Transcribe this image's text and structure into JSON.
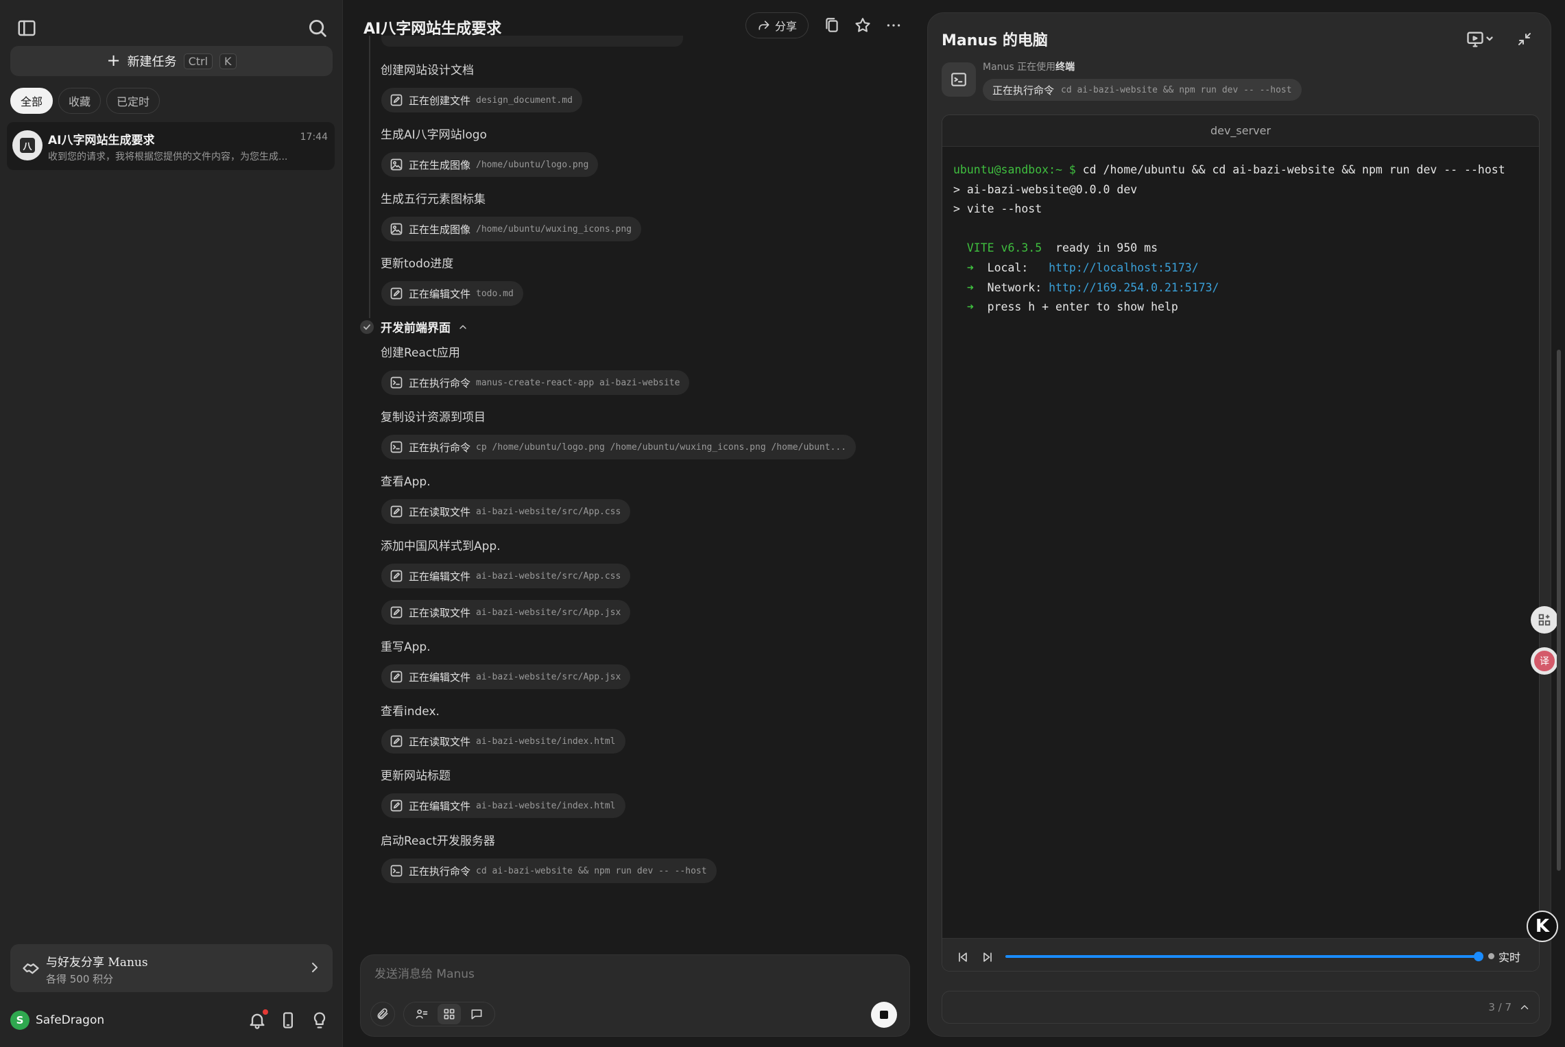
{
  "sidebar": {
    "new_task_label": "新建任务",
    "shortcut_ctrl": "Ctrl",
    "shortcut_key": "K",
    "filters": [
      "全部",
      "收藏",
      "已定时"
    ],
    "task": {
      "title": "AI八字网站生成要求",
      "time": "17:44",
      "preview": "收到您的请求，我将根据您提供的文件内容，为您生成...",
      "avatar_glyph": "八"
    },
    "share": {
      "title": "与好友分享 Manus",
      "subtitle": "各得 500 积分"
    },
    "user": {
      "initial": "S",
      "name": "SafeDragon"
    }
  },
  "chat": {
    "title": "AI八字网站生成要求",
    "share_label": "分享",
    "section_label": "开发前端界面",
    "steps": [
      {
        "title": "创建网站设计文档",
        "pills": [
          {
            "icon": "edit-icon",
            "label": "正在创建文件",
            "arg": "design_document.md"
          }
        ]
      },
      {
        "title": "生成AI八字网站logo",
        "pills": [
          {
            "icon": "image-icon",
            "label": "正在生成图像",
            "arg": "/home/ubuntu/logo.png"
          }
        ]
      },
      {
        "title": "生成五行元素图标集",
        "pills": [
          {
            "icon": "image-icon",
            "label": "正在生成图像",
            "arg": "/home/ubuntu/wuxing_icons.png"
          }
        ]
      },
      {
        "title": "更新todo进度",
        "pills": [
          {
            "icon": "edit-icon",
            "label": "正在编辑文件",
            "arg": "todo.md"
          }
        ]
      },
      {
        "title": "创建React应用",
        "pills": [
          {
            "icon": "terminal-icon",
            "label": "正在执行命令",
            "arg": "manus-create-react-app ai-bazi-website"
          }
        ]
      },
      {
        "title": "复制设计资源到项目",
        "pills": [
          {
            "icon": "terminal-icon",
            "label": "正在执行命令",
            "arg": "cp /home/ubuntu/logo.png /home/ubuntu/wuxing_icons.png /home/ubunt..."
          }
        ]
      },
      {
        "title": "查看App.",
        "pills": [
          {
            "icon": "edit-icon",
            "label": "正在读取文件",
            "arg": "ai-bazi-website/src/App.css"
          }
        ]
      },
      {
        "title": "添加中国风样式到App.",
        "pills": [
          {
            "icon": "edit-icon",
            "label": "正在编辑文件",
            "arg": "ai-bazi-website/src/App.css"
          },
          {
            "icon": "edit-icon",
            "label": "正在读取文件",
            "arg": "ai-bazi-website/src/App.jsx"
          }
        ]
      },
      {
        "title": "重写App.",
        "pills": [
          {
            "icon": "edit-icon",
            "label": "正在编辑文件",
            "arg": "ai-bazi-website/src/App.jsx"
          }
        ]
      },
      {
        "title": "查看index.",
        "pills": [
          {
            "icon": "edit-icon",
            "label": "正在读取文件",
            "arg": "ai-bazi-website/index.html"
          }
        ]
      },
      {
        "title": "更新网站标题",
        "pills": [
          {
            "icon": "edit-icon",
            "label": "正在编辑文件",
            "arg": "ai-bazi-website/index.html"
          }
        ]
      },
      {
        "title": "启动React开发服务器",
        "pills": [
          {
            "icon": "terminal-icon",
            "label": "正在执行命令",
            "arg": "cd ai-bazi-website && npm run dev -- --host"
          }
        ]
      }
    ],
    "composer_placeholder": "发送消息给 Manus"
  },
  "computer": {
    "title": "Manus 的电脑",
    "using_prefix": "Manus 正在使用",
    "using_tool": "终端",
    "cmd_label": "正在执行命令",
    "cmd_arg": "cd ai-bazi-website && npm run dev -- --host",
    "terminal_title": "dev_server",
    "terminal": {
      "prompt": "ubuntu@sandbox:~ $",
      "command": " cd /home/ubuntu && cd ai-bazi-website && npm run dev -- --host",
      "line2": "> ai-bazi-website@0.0.0 dev",
      "line3": "> vite --host",
      "vite_version": "VITE v6.3.5",
      "ready": "  ready in 950 ms",
      "arrow": "➜",
      "local_label": "  Local:   ",
      "local_url": "http://localhost:5173/",
      "network_label": "  Network: ",
      "network_url": "http://169.254.0.21:5173/",
      "help_line": "  press h + enter to show help"
    },
    "progress_fraction": 1.0,
    "live_label": "实时",
    "page_indicator": "3 / 7"
  },
  "side": {
    "translate_glyph": "译",
    "k_badge": "K"
  },
  "colors": {
    "accent": "#1a8cff",
    "terminal_green": "#3fbf3f",
    "terminal_link": "#3aa0d8",
    "notification": "#e53935"
  }
}
